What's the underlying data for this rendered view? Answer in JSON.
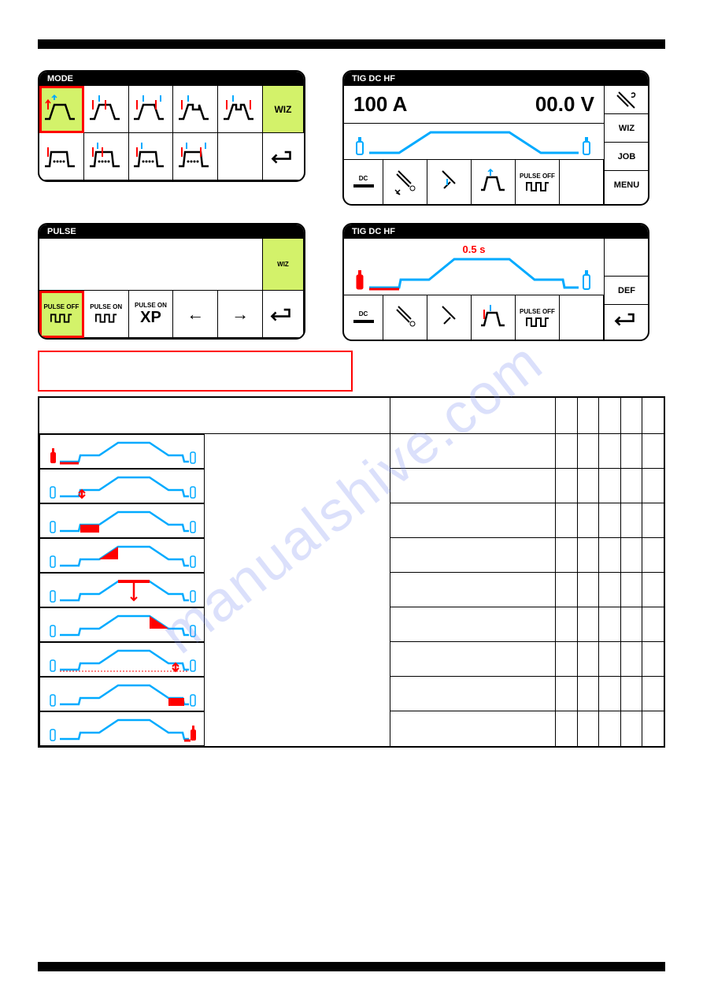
{
  "watermark": "manualshive.com",
  "header": {
    "left": "",
    "right": ""
  },
  "sections": {
    "mode": {
      "instruction": "",
      "title": "MODE",
      "wiz": "WIZ"
    },
    "main": {
      "instruction": "",
      "title": "TIG DC HF",
      "current": "100 A",
      "voltage": "00.0 V",
      "status": {
        "dc": "DC",
        "pulse": "PULSE OFF"
      },
      "buttons": [
        "WIZ",
        "JOB",
        "MENU"
      ]
    },
    "pulse": {
      "instruction": "",
      "title": "PULSE",
      "wiz": "WIZ",
      "options": [
        "PULSE OFF",
        "PULSE ON",
        "PULSE ON"
      ],
      "xp": "XP"
    },
    "param": {
      "instruction": "",
      "title": "TIG DC HF",
      "value_label": "0.5 s",
      "status": {
        "dc": "DC",
        "pulse": "PULSE OFF"
      },
      "buttons": [
        "DEF"
      ]
    }
  },
  "table": {
    "heading": "",
    "subheading": "",
    "headers": [
      "",
      "",
      "",
      "",
      "",
      "",
      ""
    ],
    "def_note": "",
    "rows": [
      {
        "desc": "",
        "min": "",
        "def": "",
        "max": "",
        "unit": "",
        "res": ""
      },
      {
        "desc": "",
        "min": "",
        "def": "",
        "max": "",
        "unit": "",
        "res": ""
      },
      {
        "desc": "",
        "min": "",
        "def": "",
        "max": "",
        "unit": "",
        "res": ""
      },
      {
        "desc": "",
        "min": "",
        "def": "",
        "max": "",
        "unit": "",
        "res": ""
      },
      {
        "desc": "",
        "min": "",
        "def": "",
        "max": "",
        "unit": "",
        "res": ""
      },
      {
        "desc": "",
        "min": "",
        "def": "",
        "max": "",
        "unit": "",
        "res": ""
      },
      {
        "desc": "",
        "min": "",
        "def": "",
        "max": "",
        "unit": "",
        "res": ""
      },
      {
        "desc": "",
        "min": "",
        "def": "",
        "max": "",
        "unit": "",
        "res": ""
      },
      {
        "desc": "",
        "min": "",
        "def": "",
        "max": "",
        "unit": "",
        "res": ""
      }
    ]
  },
  "footer": {
    "page": ""
  }
}
